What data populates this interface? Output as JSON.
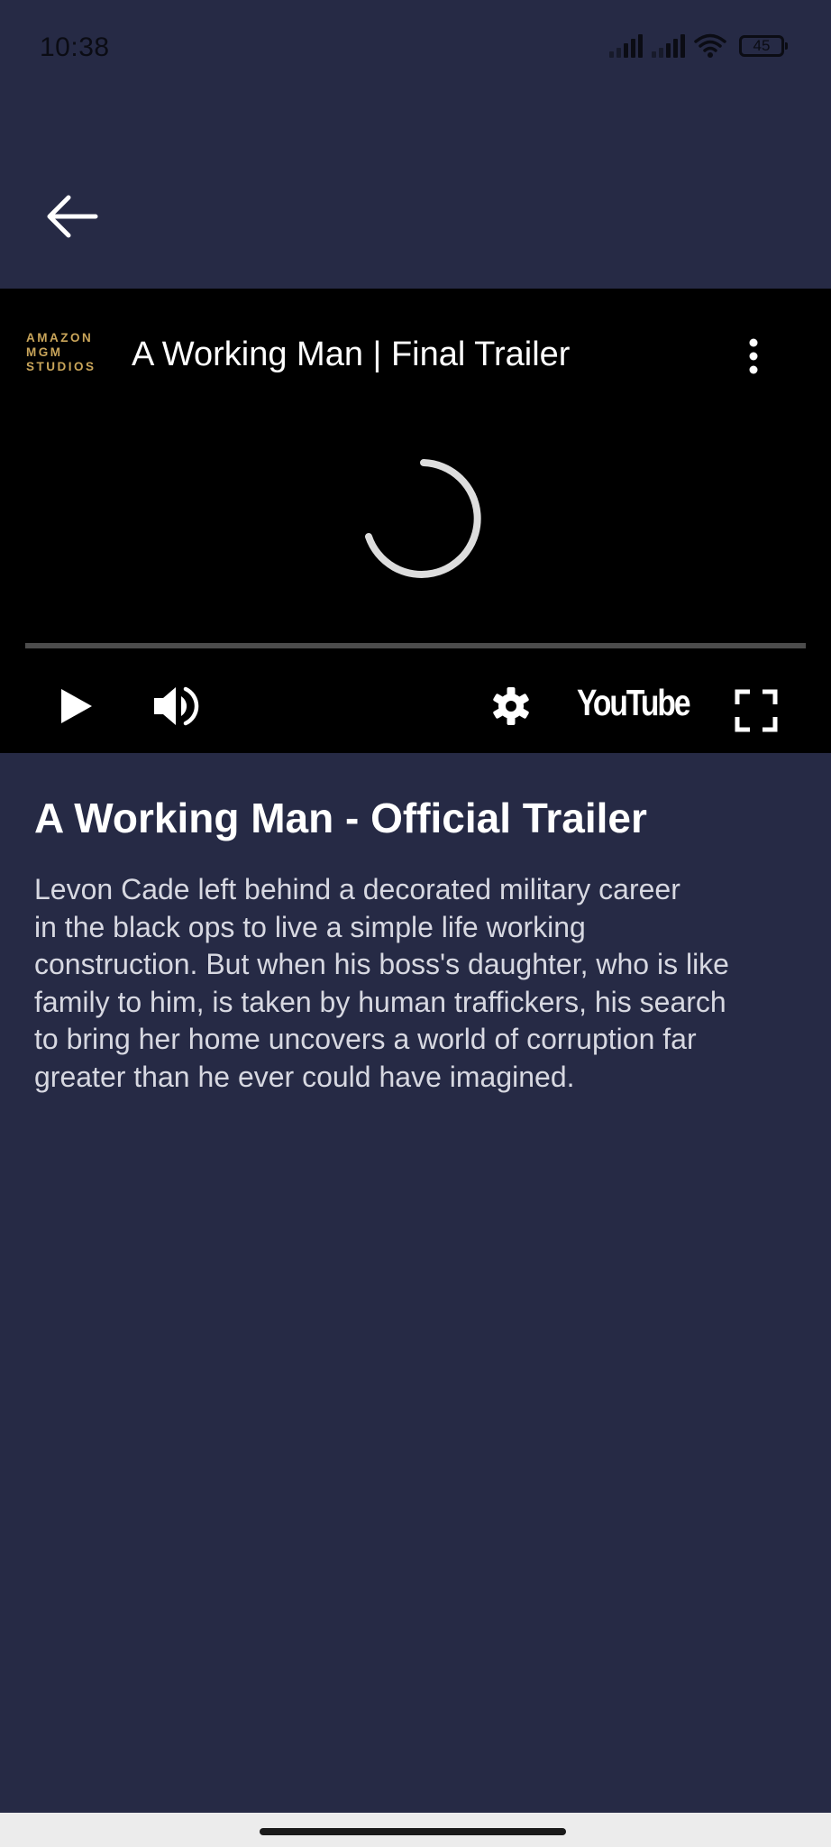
{
  "status_bar": {
    "time": "10:38",
    "battery_level": "45",
    "icons": [
      "cellular-signal-icon",
      "cellular-signal-icon",
      "wifi-icon",
      "battery-icon"
    ]
  },
  "toolbar": {
    "back_icon": "arrow-left-icon"
  },
  "player": {
    "channel_logo_lines": [
      "AMAZON",
      "MGM",
      "STUDIOS"
    ],
    "video_title": "A Working Man | Final Trailer",
    "more_icon": "more-vertical-icon",
    "loading": true,
    "progress_fraction": 0,
    "controls": {
      "play_icon": "play-icon",
      "volume_icon": "volume-icon",
      "settings_icon": "gear-icon",
      "youtube_label": "YouTube",
      "fullscreen_icon": "fullscreen-icon"
    },
    "colors": {
      "background": "#000000",
      "track": "#4c4c4c",
      "spinner": "#dddddd",
      "logo_gold": "#c9a55a"
    }
  },
  "content": {
    "title": "A Working Man - Official Trailer",
    "description_lines": [
      "Levon Cade left behind a decorated military career",
      "in the black ops to live a simple life working",
      "construction. But when his boss's daughter, who is like",
      "family to him, is taken by human traffickers, his search",
      "to bring her home uncovers a world of corruption far",
      "greater than he ever could have imagined."
    ]
  },
  "theme": {
    "background": "#262a45",
    "text": "#ffffff",
    "description_text": "#d7d8e1",
    "nav_bar": "#ececec"
  }
}
